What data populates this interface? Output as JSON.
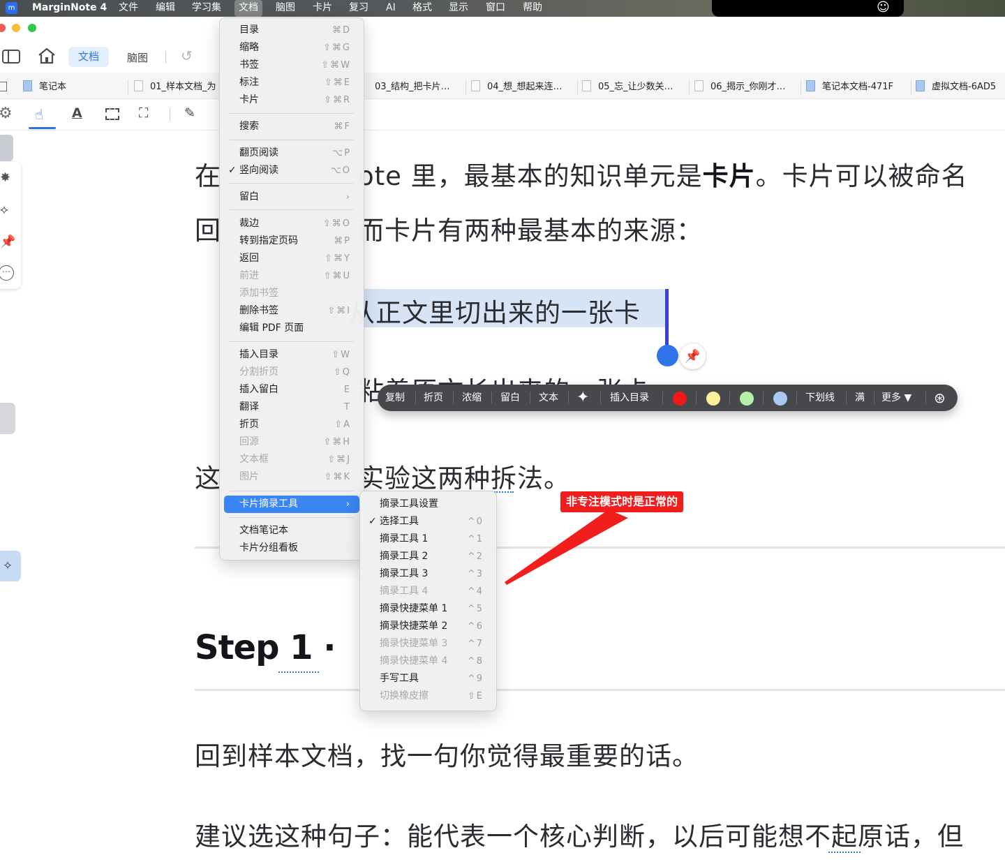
{
  "menubar": {
    "app_name": "MarginNote 4",
    "items": [
      "文件",
      "编辑",
      "学习集",
      "文档",
      "脑图",
      "卡片",
      "复习",
      "AI",
      "格式",
      "显示",
      "窗口",
      "帮助"
    ]
  },
  "toolbar": {
    "mode_doc": "文档",
    "mode_mindmap": "脑图"
  },
  "tabs": [
    "笔记本",
    "01_样本文档_为",
    "03_结构_把卡片…",
    "04_想_想起来连…",
    "05_忘_让少数关…",
    "06_揭示_你刚才…",
    "笔记本文档-471F",
    "虚拟文档-6AD5"
  ],
  "doc": {
    "line1_a": "在",
    "line1_b": "ote  里，最基本的知识单元是",
    "line1_bold": "卡片",
    "line1_c": "。卡片可以被命名",
    "line2_a": "回",
    "line2_b": "而卡片有两种最基本的来源：",
    "highlight": "从正文里切出来的一张卡",
    "line4": "粘着原文长出来的一张卡",
    "line5_a": "这",
    "line5_b": "实验这两种拆法。",
    "step_title": "Step 1 ·",
    "para1": "回到样本文档，找一句你觉得最重要的话。",
    "para2": "建议选这种句子：能代表一个核心判断，以后可能想不起原话，但"
  },
  "doc_menu": [
    {
      "label": "目录",
      "sc": "⌘D"
    },
    {
      "label": "缩略",
      "sc": "⇧⌘G"
    },
    {
      "label": "书签",
      "sc": "⇧⌘W"
    },
    {
      "label": "标注",
      "sc": "⇧⌘E"
    },
    {
      "label": "卡片",
      "sc": "⇧⌘R"
    },
    {
      "label": "搜索",
      "sc": "⌘F"
    },
    {
      "label": "翻页阅读",
      "sc": "⌥P"
    },
    {
      "label": "竖向阅读",
      "sc": "⌥O",
      "checked": "✓"
    },
    {
      "label": "留白",
      "sc": "›"
    },
    {
      "label": "裁边",
      "sc": "⇧⌘O"
    },
    {
      "label": "转到指定页码",
      "sc": "⌘P"
    },
    {
      "label": "返回",
      "sc": "⇧⌘Y"
    },
    {
      "label": "前进",
      "sc": "⇧⌘U",
      "disabled": true
    },
    {
      "label": "添加书签",
      "sc": "",
      "disabled": true
    },
    {
      "label": "删除书签",
      "sc": "⇧⌘I"
    },
    {
      "label": "编辑 PDF 页面",
      "sc": ""
    },
    {
      "label": "插入目录",
      "sc": "⇧W"
    },
    {
      "label": "分割折页",
      "sc": "⇧Q",
      "disabled": true
    },
    {
      "label": "插入留白",
      "sc": "E"
    },
    {
      "label": "翻译",
      "sc": "T"
    },
    {
      "label": "折页",
      "sc": "⇧A"
    },
    {
      "label": "回源",
      "sc": "⇧⌘H",
      "disabled": true
    },
    {
      "label": "文本框",
      "sc": "⇧⌘J",
      "disabled": true
    },
    {
      "label": "图片",
      "sc": "⇧⌘K",
      "disabled": true
    },
    {
      "label": "卡片摘录工具",
      "sc": "›",
      "highlighted": true
    },
    {
      "label": "文档笔记本",
      "sc": ""
    },
    {
      "label": "卡片分组看板",
      "sc": ""
    }
  ],
  "sub_menu": [
    {
      "label": "摘录工具设置",
      "sc": ""
    },
    {
      "label": "选择工具",
      "sc": "^0",
      "checked": "✓"
    },
    {
      "label": "摘录工具 1",
      "sc": "^1"
    },
    {
      "label": "摘录工具 2",
      "sc": "^2"
    },
    {
      "label": "摘录工具 3",
      "sc": "^3"
    },
    {
      "label": "摘录工具 4",
      "sc": "^4",
      "disabled": true
    },
    {
      "label": "摘录快捷菜单 1",
      "sc": "^5"
    },
    {
      "label": "摘录快捷菜单 2",
      "sc": "^6"
    },
    {
      "label": "摘录快捷菜单 3",
      "sc": "^7",
      "disabled": true
    },
    {
      "label": "摘录快捷菜单 4",
      "sc": "^8",
      "disabled": true
    },
    {
      "label": "手写工具",
      "sc": "^9"
    },
    {
      "label": "切换橡皮擦",
      "sc": "⇧E",
      "disabled": true
    }
  ],
  "ctxbar": {
    "copy": "复制",
    "fold": "折页",
    "condense": "浓缩",
    "blank": "留白",
    "text": "文本",
    "insert_toc": "插入目录",
    "underline": "下划线",
    "fill": "满",
    "more": "更多 ▼",
    "colors": [
      "#f01818",
      "#fdf29a",
      "#b6f0a8",
      "#a9c8f2"
    ]
  },
  "annotation": {
    "label": "非专注模式时是正常的",
    "color": "#f21d1d"
  }
}
